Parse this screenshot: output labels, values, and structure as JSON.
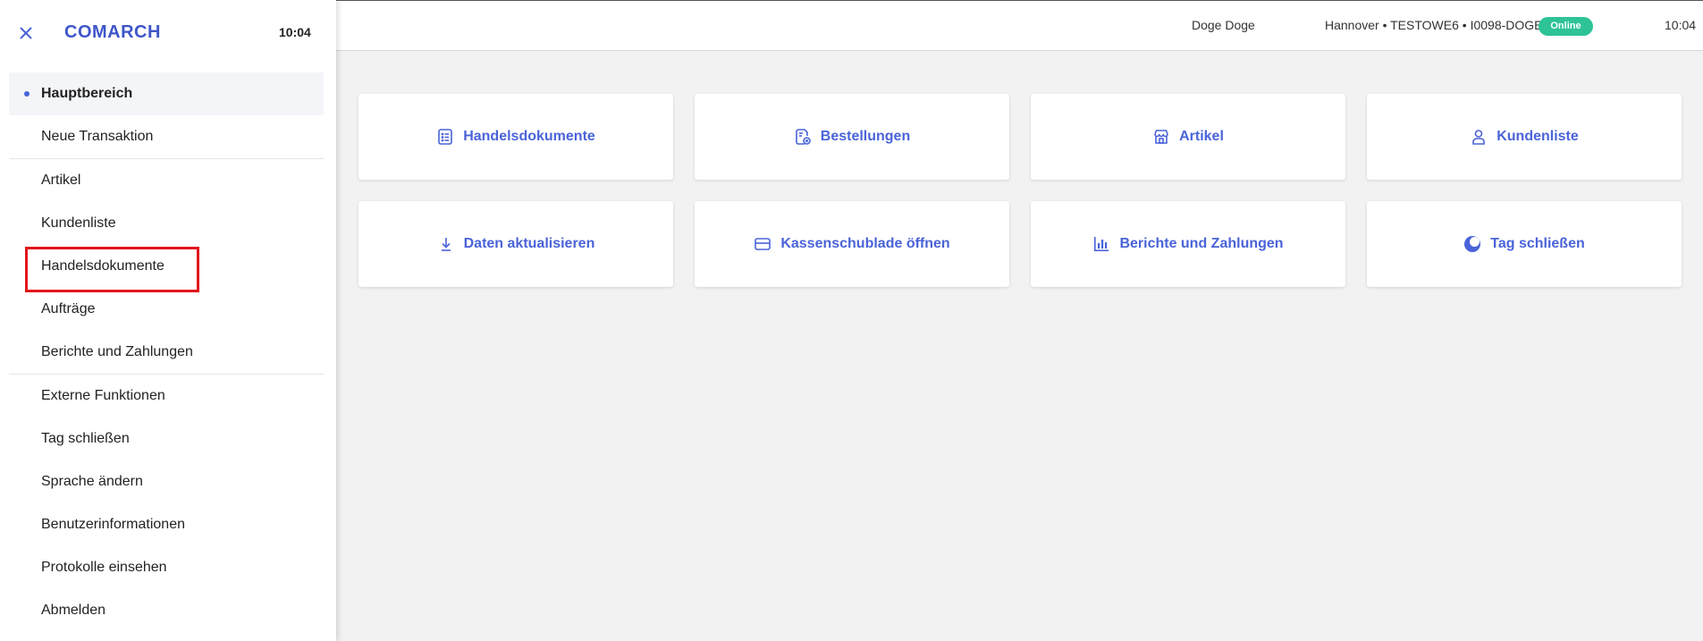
{
  "header": {
    "user": "Doge Doge",
    "store": "Hannover • TESTOWE6 • I0098-DOGE",
    "status": "Online",
    "time": "10:04"
  },
  "tiles": [
    {
      "label": "Handelsdokumente",
      "icon": "document-list-icon"
    },
    {
      "label": "Bestellungen",
      "icon": "order-add-icon"
    },
    {
      "label": "Artikel",
      "icon": "store-icon"
    },
    {
      "label": "Kundenliste",
      "icon": "person-icon"
    },
    {
      "label": "Daten aktualisieren",
      "icon": "download-icon"
    },
    {
      "label": "Kassenschublade öffnen",
      "icon": "card-icon"
    },
    {
      "label": "Berichte und Zahlungen",
      "icon": "bar-chart-icon"
    },
    {
      "label": "Tag schließen",
      "icon": "moon-icon"
    }
  ],
  "sidebar": {
    "logo": "COMARCH",
    "time": "10:04",
    "items": [
      {
        "label": "Hauptbereich"
      },
      {
        "label": "Neue Transaktion"
      },
      {
        "label": "Artikel"
      },
      {
        "label": "Kundenliste"
      },
      {
        "label": "Handelsdokumente"
      },
      {
        "label": "Aufträge"
      },
      {
        "label": "Berichte und Zahlungen"
      },
      {
        "label": "Externe Funktionen"
      },
      {
        "label": "Tag schließen"
      },
      {
        "label": "Sprache ändern"
      },
      {
        "label": "Benutzerinformationen"
      },
      {
        "label": "Protokolle einsehen"
      },
      {
        "label": "Abmelden"
      }
    ]
  },
  "colors": {
    "accent": "#4a63d8",
    "online": "#2ec397",
    "highlight": "#e1161c"
  }
}
